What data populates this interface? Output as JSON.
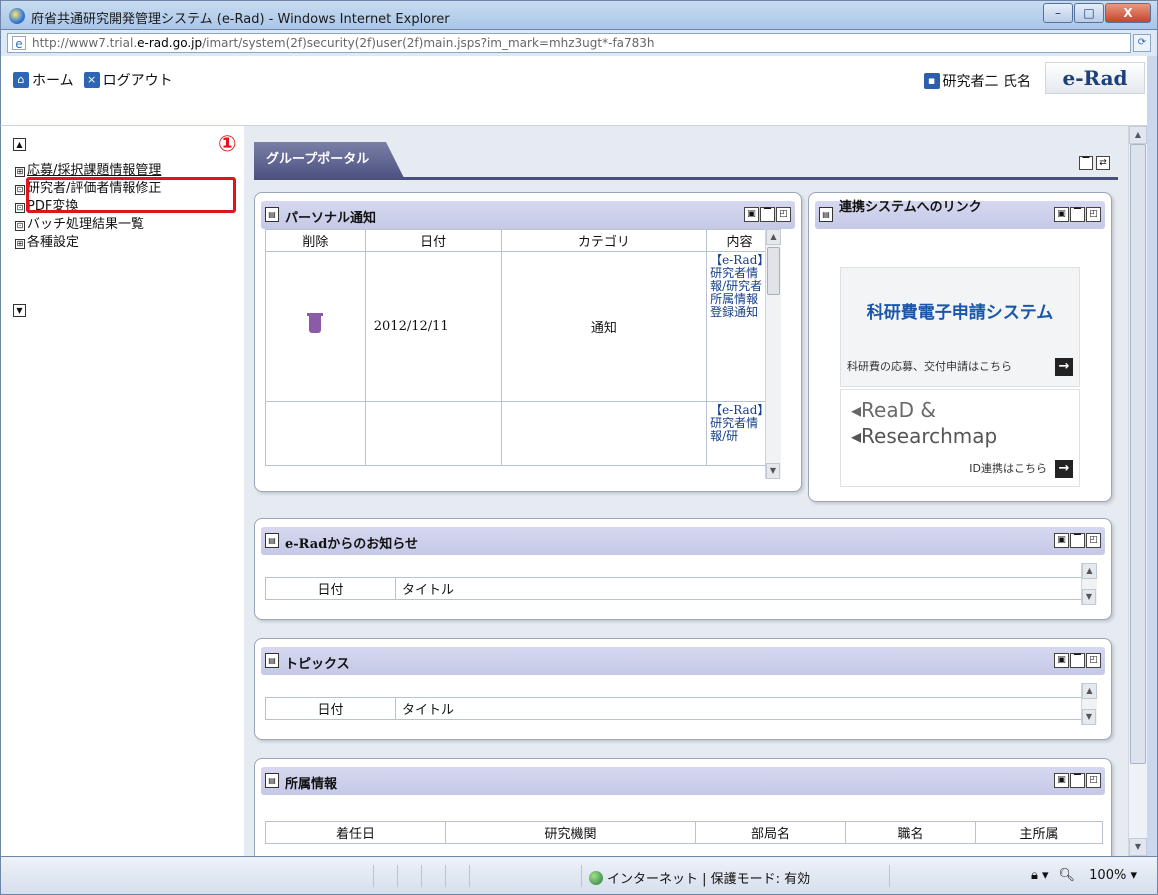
{
  "window": {
    "title": "府省共通研究開発管理システム (e-Rad) - Windows Internet Explorer",
    "minimize": "–",
    "maximize": "□",
    "close": "X"
  },
  "address": {
    "url_prefix": "http://www7.trial.",
    "url_domain": "e-rad.go.jp",
    "url_path": "/imart/system(2f)security(2f)user(2f)main.jsps?im_mark=mhz3ugt*-fa783h"
  },
  "header": {
    "home_label": "ホーム",
    "logout_label": "ログアウト",
    "user_name": "研究者二 氏名",
    "logo_text": "e-Rad"
  },
  "sidebar": {
    "items": [
      {
        "label": "応募/採択課題情報管理",
        "marker": "⊞"
      },
      {
        "label": "研究者/評価者情報修正",
        "marker": "⊡"
      },
      {
        "label": "PDF変換",
        "marker": "⊡"
      },
      {
        "label": "バッチ処理結果一覧",
        "marker": "⊡"
      },
      {
        "label": "各種設定",
        "marker": "⊞"
      }
    ],
    "callout": "①"
  },
  "portal": {
    "tab_label": "グループポータル"
  },
  "personal_notice": {
    "title": "パーソナル通知",
    "columns": [
      "削除",
      "日付",
      "カテゴリ",
      "内容"
    ],
    "rows": [
      {
        "date": "2012/12/11",
        "category": "通知",
        "content": "【e-Rad】研究者情報/研究者所属情報登録通知"
      },
      {
        "date": "",
        "category": "",
        "content": "【e-Rad】研究者情報/研"
      }
    ]
  },
  "links": {
    "title": "連携システムへのリンク",
    "kaken_title": "科研費電子申請システム",
    "kaken_sub": "科研費の応募、交付申請はこちら",
    "read_title": "ReaD &",
    "researchmap_title": "Researchmap",
    "read_sub": "ID連携はこちら"
  },
  "erad_news": {
    "title": "e-Radからのお知らせ",
    "columns": [
      "日付",
      "タイトル"
    ]
  },
  "topics": {
    "title": "トピックス",
    "columns": [
      "日付",
      "タイトル"
    ]
  },
  "affiliation": {
    "title": "所属情報",
    "columns": [
      "着任日",
      "研究機関",
      "部局名",
      "職名",
      "主所属"
    ]
  },
  "status": {
    "zone": "インターネット | 保護モード: 有効",
    "zoom": "100%"
  }
}
